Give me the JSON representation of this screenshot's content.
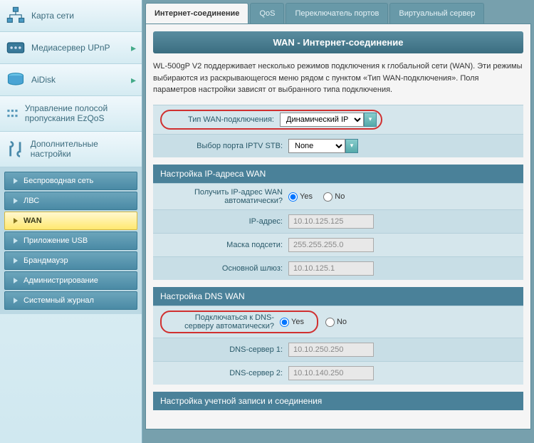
{
  "sidebar": {
    "main": [
      {
        "label": "Карта сети",
        "icon": "network"
      },
      {
        "label": "Медиасервер UPnP",
        "icon": "media",
        "arrow": true
      },
      {
        "label": "AiDisk",
        "icon": "disk",
        "arrow": true
      },
      {
        "label": "Управление полосой пропускания EzQoS",
        "icon": "qos"
      },
      {
        "label": "Дополнительные настройки",
        "icon": "tools"
      }
    ],
    "sub": [
      {
        "label": "Беспроводная сеть"
      },
      {
        "label": "ЛВС"
      },
      {
        "label": "WAN",
        "active": true
      },
      {
        "label": "Приложение USB"
      },
      {
        "label": "Брандмауэр"
      },
      {
        "label": "Администрирование"
      },
      {
        "label": "Системный журнал"
      }
    ]
  },
  "tabs": [
    {
      "label": "Интернет-соединение",
      "active": true
    },
    {
      "label": "QoS"
    },
    {
      "label": "Переключатель портов"
    },
    {
      "label": "Виртуальный сервер"
    }
  ],
  "banner": "WAN - Интернет-соединение",
  "desc": "WL-500gP V2 поддерживает несколько режимов подключения к глобальной сети (WAN). Эти режимы выбираются из раскрывающегося меню рядом с пунктом «Тип WAN-подключения». Поля параметров настройки зависят от выбранного типа подключения.",
  "fields": {
    "wan_type_label": "Тип WAN-подключения:",
    "wan_type_value": "Динамический IP",
    "iptv_label": "Выбор порта IPTV STB:",
    "iptv_value": "None",
    "ip_section": "Настройка IP-адреса WAN",
    "auto_ip_label": "Получить IP-адрес WAN автоматически?",
    "yes": "Yes",
    "no": "No",
    "ip_label": "IP-адрес:",
    "ip_value": "10.10.125.125",
    "mask_label": "Маска подсети:",
    "mask_value": "255.255.255.0",
    "gateway_label": "Основной шлюз:",
    "gateway_value": "10.10.125.1",
    "dns_section": "Настройка DNS WAN",
    "auto_dns_label": "Подключаться к DNS-серверу автоматически?",
    "dns1_label": "DNS-сервер 1:",
    "dns1_value": "10.10.250.250",
    "dns2_label": "DNS-сервер 2:",
    "dns2_value": "10.10.140.250",
    "account_section": "Настройка учетной записи и соединения"
  }
}
